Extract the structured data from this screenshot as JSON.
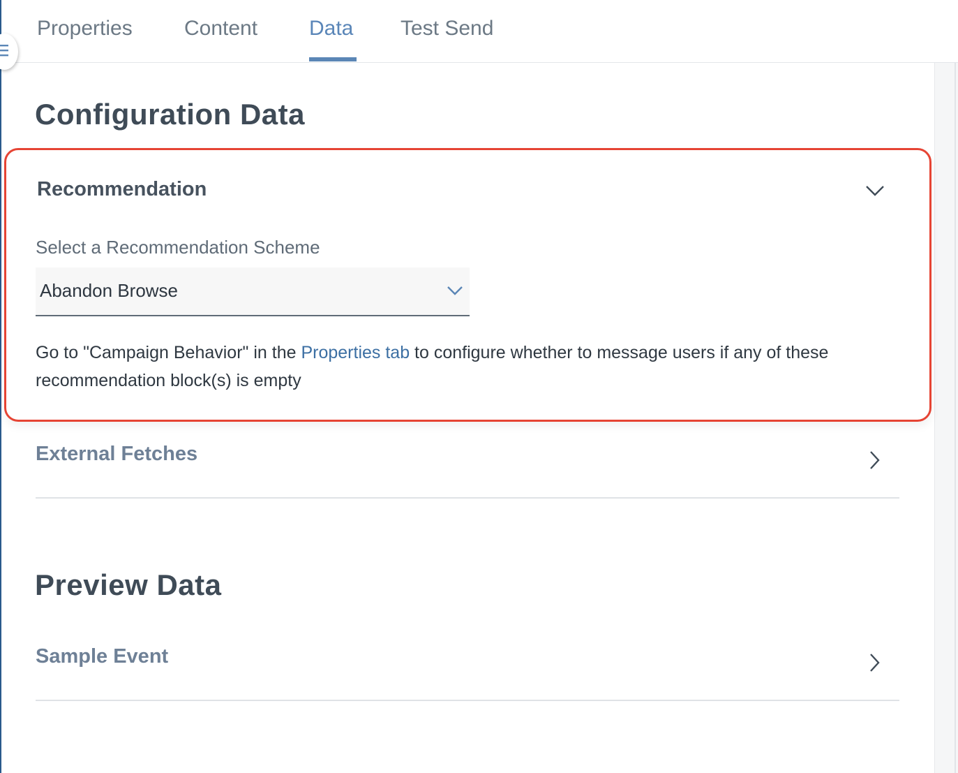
{
  "tabs": [
    {
      "label": "Properties"
    },
    {
      "label": "Content"
    },
    {
      "label": "Data"
    },
    {
      "label": "Test Send"
    }
  ],
  "active_tab": "Data",
  "configuration": {
    "title": "Configuration Data",
    "recommendation": {
      "heading": "Recommendation",
      "field_label": "Select a Recommendation Scheme",
      "selected_value": "Abandon Browse",
      "help_prefix": "Go to \"Campaign Behavior\" in the ",
      "help_link": "Properties tab",
      "help_suffix": " to configure whether to message users if any of these recommendation block(s) is empty"
    },
    "external_fetches_label": "External Fetches"
  },
  "preview": {
    "title": "Preview Data",
    "sample_event_label": "Sample Event"
  },
  "colors": {
    "accent": "#5b86b6",
    "highlight_border": "#e64434",
    "link": "#3c6fa3"
  },
  "icons": {
    "menu": "menu-icon",
    "collapse": "chevron-down-icon",
    "expand": "chevron-right-icon"
  }
}
